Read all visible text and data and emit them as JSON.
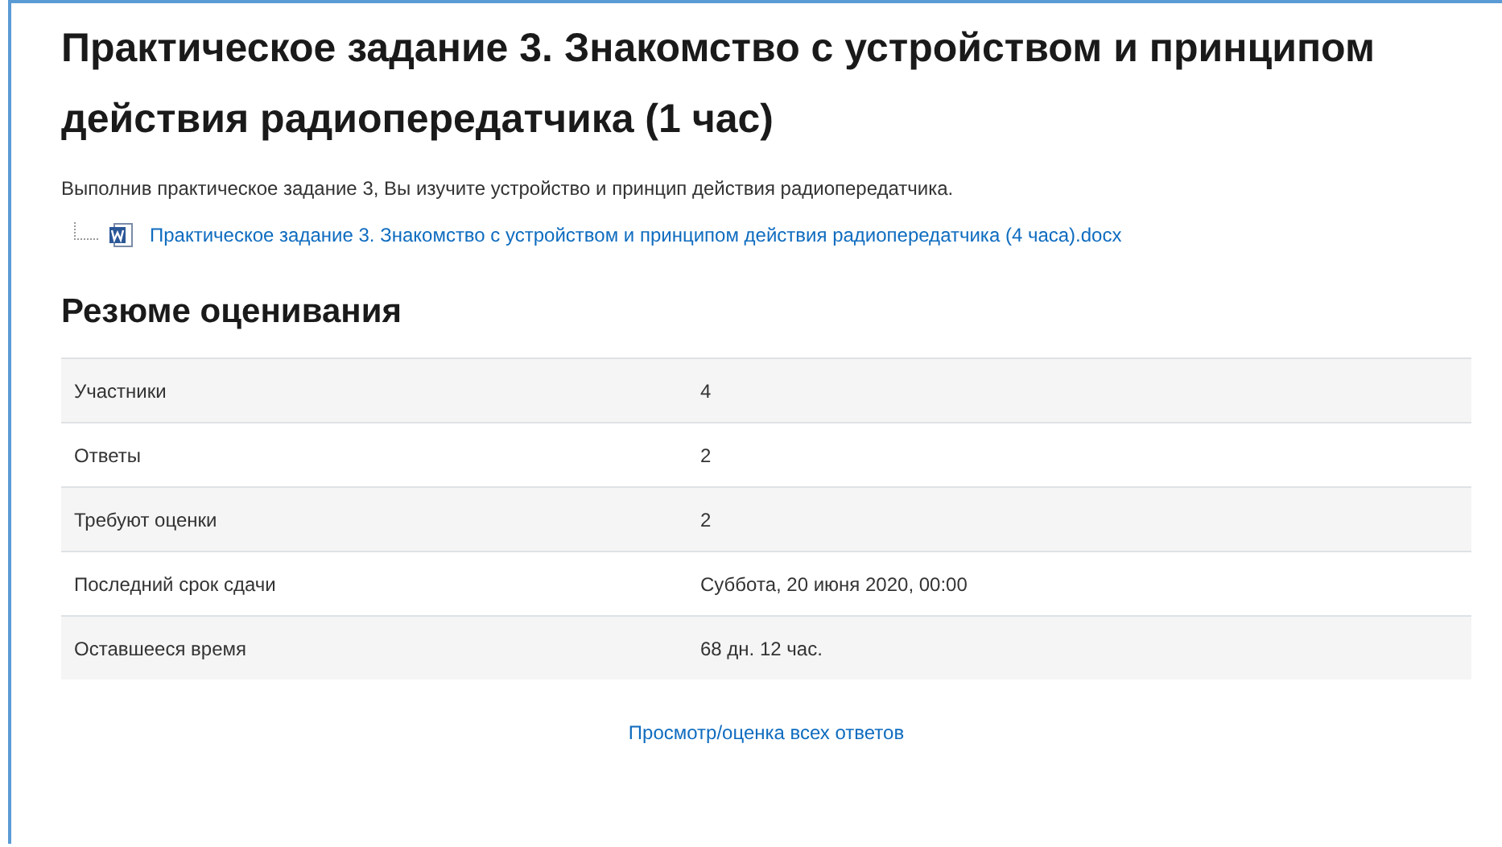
{
  "title": "Практическое задание 3. Знакомство с устройством и принципом действия радиопередатчика (1 час)",
  "description": "Выполнив практическое задание 3, Вы изучите устройство и принцип действия радиопередатчика.",
  "file": {
    "name": "Практическое задание 3. Знакомство с устройством и принципом действия радиопередатчика (4 часа).docx"
  },
  "summary": {
    "heading": "Резюме оценивания",
    "rows": [
      {
        "label": "Участники",
        "value": "4"
      },
      {
        "label": "Ответы",
        "value": "2"
      },
      {
        "label": "Требуют оценки",
        "value": "2"
      },
      {
        "label": "Последний срок сдачи",
        "value": "Суббота, 20 июня 2020, 00:00"
      },
      {
        "label": "Оставшееся время",
        "value": "68 дн. 12 час."
      }
    ]
  },
  "link": "Просмотр/оценка всех ответов"
}
